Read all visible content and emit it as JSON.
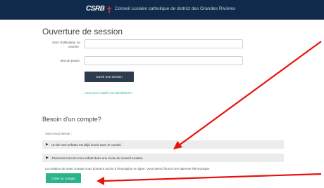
{
  "header": {
    "logo": "CSRB",
    "title": "Conseil scolaire catholique de district des Grandes Rivières"
  },
  "login": {
    "title": "Ouverture de session",
    "username_label": "Nom d'utilisateur ou courriel :",
    "password_label": "Mot de passe:",
    "username_value": "",
    "password_value": "",
    "submit_label": "Ouvrir une session",
    "forgot_label": "Vous avez oublié vos identifiants?"
  },
  "account": {
    "title": "Besoin d'un compte?",
    "intro": "Avez-vous besoin :",
    "items": [
      {
        "label": "Un de mes enfants est déjà inscrit avec le conseil."
      },
      {
        "label": "J'aimerais inscrire mon enfant dans une école du conseil scolaire."
      }
    ],
    "note": "La création de votre compte vous donnera accès à l'inscription en ligne. Vous devez fournir une adresse électronique.",
    "create_label": "Créer un compte"
  },
  "colors": {
    "topbar": "#0f2a4a",
    "accent": "#2bb38a",
    "arrow": "#e8120c"
  }
}
